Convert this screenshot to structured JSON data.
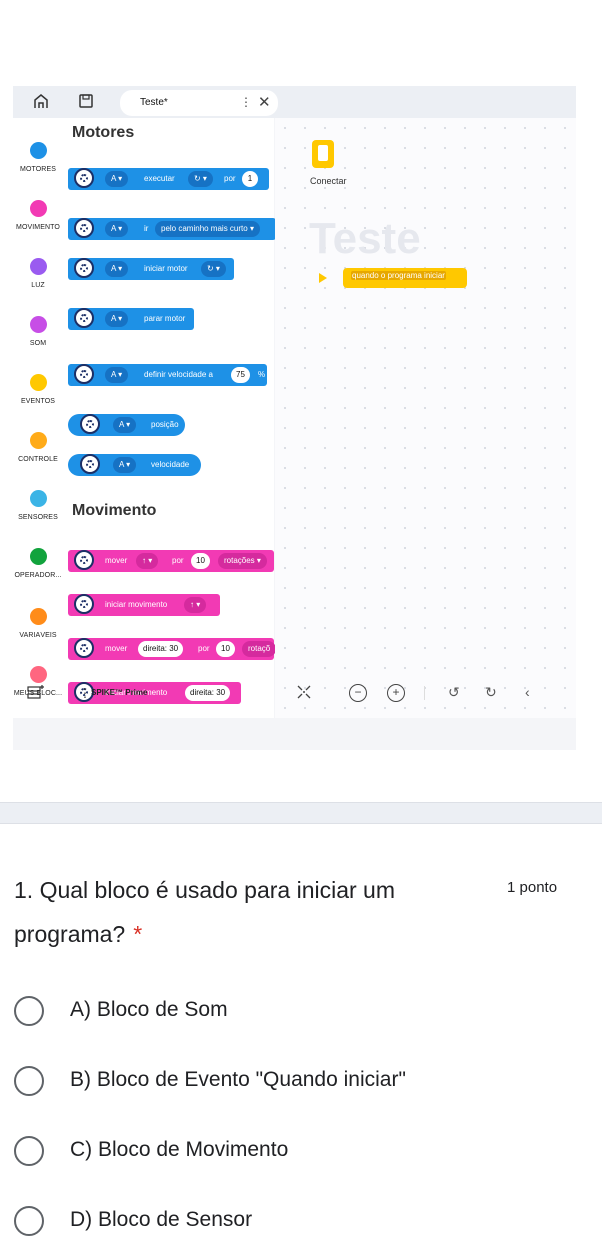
{
  "app": {
    "tab_title": "Teste*",
    "tab_menu": "⋮",
    "tab_close": "✕",
    "categories": [
      {
        "label": "MOTORES",
        "color": "#1e91e6"
      },
      {
        "label": "MOVIMENTO",
        "color": "#f23ab4"
      },
      {
        "label": "LUZ",
        "color": "#9a5bf0"
      },
      {
        "label": "SOM",
        "color": "#c74ee6"
      },
      {
        "label": "EVENTOS",
        "color": "#ffc800"
      },
      {
        "label": "CONTROLE",
        "color": "#ffab19"
      },
      {
        "label": "SENSORES",
        "color": "#3bb4e6"
      },
      {
        "label": "OPERADOR...",
        "color": "#12a33d"
      },
      {
        "label": "VARIÁVEIS",
        "color": "#ff8c1a"
      },
      {
        "label": "MEUS BLOC...",
        "color": "#ff6680"
      }
    ],
    "palette": {
      "motores_title": "Motores",
      "movimento_title": "Movimento",
      "port": "A",
      "executar": "executar",
      "por": "por",
      "executar_value": "1",
      "ir": "ir",
      "caminho": "pelo caminho mais curto",
      "iniciar_motor": "iniciar motor",
      "parar_motor": "parar motor",
      "definir_velocidade": "definir velocidade a",
      "velocidade_value": "75",
      "percent": "%",
      "posicao": "posição",
      "velocidade": "velocidade",
      "mover": "mover",
      "mover_por": "por",
      "mover_value": "10",
      "rotacoes": "rotações",
      "iniciar_movimento": "iniciar movimento",
      "arrow_up": "↑",
      "mover2": "mover",
      "direita_30": "direita: 30",
      "por2": "por",
      "mover2_value": "10",
      "rotacoes2": "rotaçõ",
      "iniciar_movimento2": "iniciar movimento",
      "direita_30_b": "direita: 30"
    },
    "canvas": {
      "connect_label": "Conectar",
      "project_title": "Teste",
      "event_block": "quando o programa iniciar"
    },
    "bottom": {
      "device_name": "SPIKE™ Prime",
      "device_menu": "⋮",
      "zoom_out": "−",
      "zoom_in": "+",
      "undo": "↺",
      "redo": "↻",
      "collapse": "‹"
    }
  },
  "form": {
    "question": "1. Qual bloco é usado para iniciar um programa?",
    "required_marker": "*",
    "points": "1 ponto",
    "options": [
      "A) Bloco de Som",
      "B) Bloco de Evento \"Quando iniciar\"",
      "C) Bloco de Movimento",
      "D) Bloco de Sensor"
    ]
  }
}
